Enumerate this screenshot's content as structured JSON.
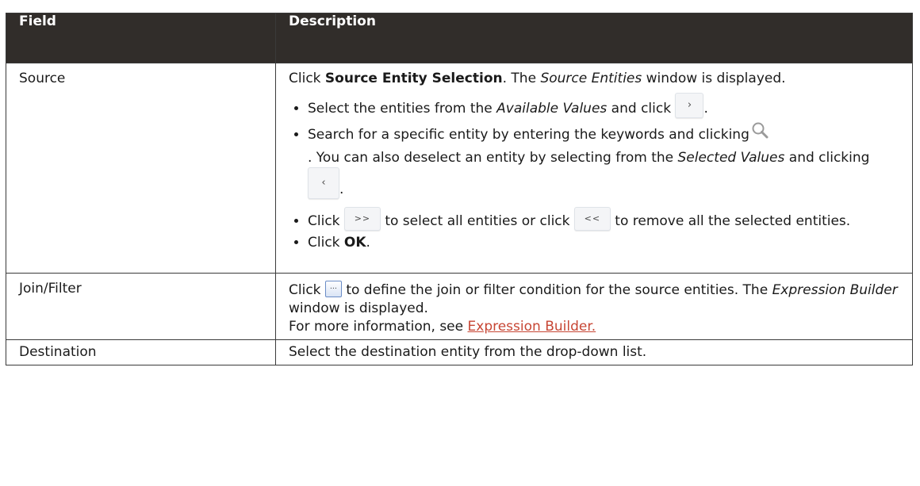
{
  "table": {
    "headers": [
      "Field",
      "Description"
    ],
    "rows": {
      "source": {
        "field": "Source",
        "intro": {
          "pre": "Click ",
          "bold": "Source Entity Selection",
          "mid": ". The ",
          "italic": "Source Entities",
          "post": " window is displayed."
        },
        "b1": {
          "pre": "Select the entities from the ",
          "italic": "Available Values",
          "post": " and click ",
          "end": "."
        },
        "b2": {
          "pre": "Search for a specific entity by entering the keywords and clicking",
          "mid": ". You can also deselect an entity by selecting from the ",
          "italic": "Selected Values",
          "post": " and clicking ",
          "end": "."
        },
        "b3": {
          "pre": "Click ",
          "mid": " to select all entities or click ",
          "post": " to remove all the selected entities."
        },
        "b4": {
          "pre": "Click ",
          "bold": "OK",
          "post": "."
        }
      },
      "join": {
        "field": "Join/Filter",
        "line1": {
          "pre": "Click ",
          "post": " to define the join or filter condition for the source entities. The "
        },
        "italic": "Expression Builder",
        "line1_end": " window is displayed.",
        "line2": {
          "pre": "For more information, see ",
          "link": "Expression Builder."
        }
      },
      "destination": {
        "field": "Destination",
        "desc": "Select the destination entity from the drop-down list."
      }
    }
  },
  "buttons": {
    "select_one": "›",
    "deselect_one": "‹",
    "select_all": ">>",
    "deselect_all": "<<",
    "ellipsis": "…"
  },
  "colors": {
    "header_bg": "#312d2a",
    "link": "#c74634"
  }
}
